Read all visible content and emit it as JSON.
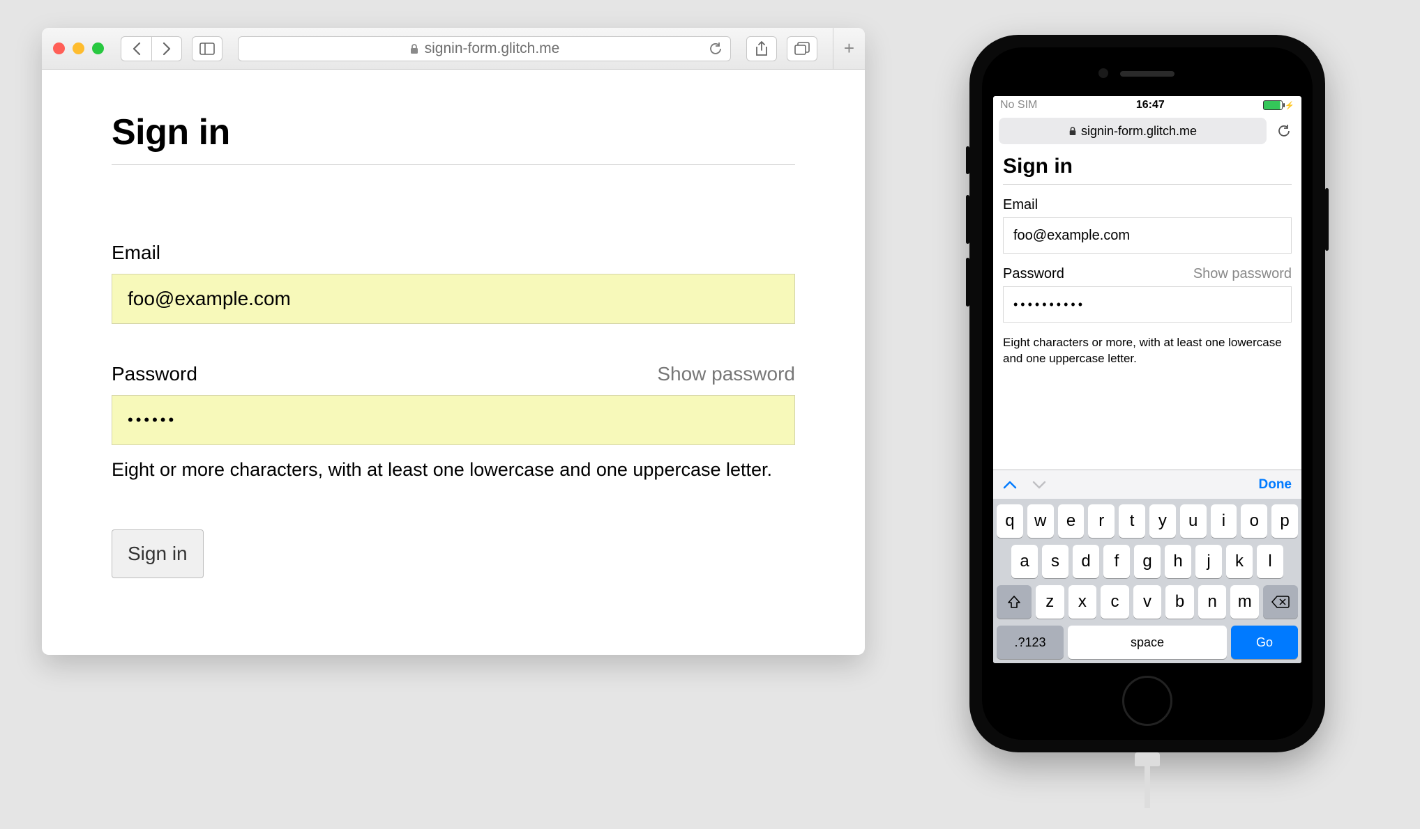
{
  "desktop": {
    "url_domain": "signin-form.glitch.me",
    "form": {
      "title": "Sign in",
      "email_label": "Email",
      "email_value": "foo@example.com",
      "password_label": "Password",
      "show_password": "Show password",
      "password_masked": "••••••",
      "hint": "Eight or more characters, with at least one lowercase and one uppercase letter.",
      "submit": "Sign in"
    }
  },
  "mobile": {
    "status": {
      "carrier": "No SIM",
      "time": "16:47"
    },
    "url_domain": "signin-form.glitch.me",
    "form": {
      "title": "Sign in",
      "email_label": "Email",
      "email_value": "foo@example.com",
      "password_label": "Password",
      "show_password": "Show password",
      "password_masked": "••••••••••",
      "hint": "Eight characters or more, with at least one lowercase and one uppercase letter."
    },
    "keyboard": {
      "done": "Done",
      "row1": [
        "q",
        "w",
        "e",
        "r",
        "t",
        "y",
        "u",
        "i",
        "o",
        "p"
      ],
      "row2": [
        "a",
        "s",
        "d",
        "f",
        "g",
        "h",
        "j",
        "k",
        "l"
      ],
      "row3": [
        "z",
        "x",
        "c",
        "v",
        "b",
        "n",
        "m"
      ],
      "numbers_key": ".?123",
      "space_key": "space",
      "go_key": "Go"
    }
  }
}
